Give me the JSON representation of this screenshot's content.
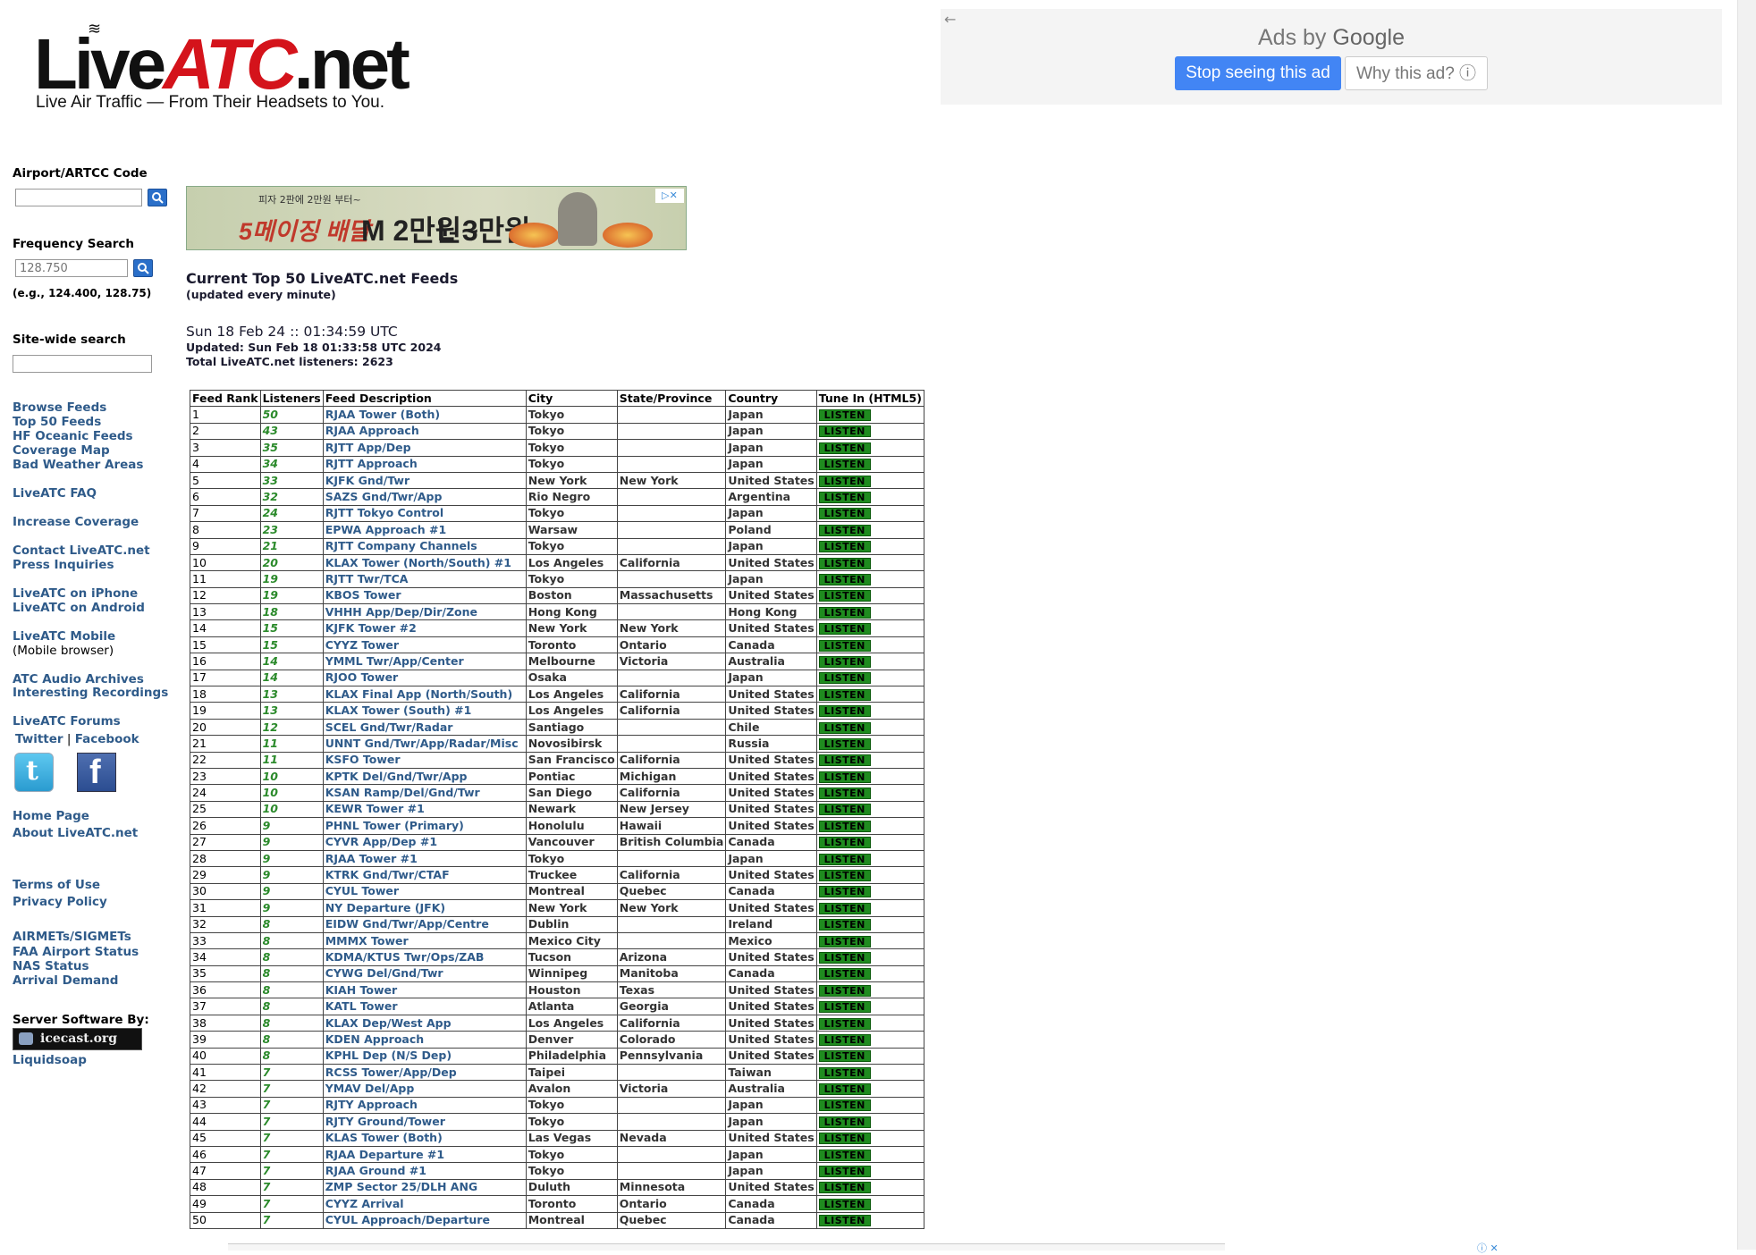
{
  "logo": {
    "live": "Live",
    "atc": "ATC",
    "net": ".net",
    "tagline": "Live Air Traffic — From Their Headsets to You."
  },
  "google_ad": {
    "back": "←",
    "ads_by": "Ads by",
    "google": "Google",
    "stop": "Stop seeing this ad",
    "why": "Why this ad? ⓘ"
  },
  "sidebar": {
    "airport_label": "Airport/ARTCC Code",
    "airport_value": "",
    "freq_label": "Frequency Search",
    "freq_placeholder": "128.750",
    "freq_note": "(e.g., 124.400, 128.75)",
    "site_label": "Site-wide search",
    "links": {
      "browse": "Browse Feeds",
      "top50": "Top 50 Feeds",
      "hf": "HF Oceanic Feeds",
      "coverage_map": "Coverage Map",
      "bad_weather": "Bad Weather Areas",
      "faq": "LiveATC FAQ",
      "increase": "Increase Coverage",
      "contact": "Contact LiveATC.net",
      "press": "Press Inquiries",
      "iphone": "LiveATC on iPhone",
      "android": "LiveATC on Android",
      "mobile": "LiveATC Mobile",
      "mobile_note": "(Mobile browser)",
      "archives": "ATC Audio Archives",
      "recordings": "Interesting Recordings",
      "forums": "LiveATC Forums",
      "twitter": "Twitter",
      "sep": "|",
      "facebook": "Facebook",
      "home": "Home Page",
      "about": "About LiveATC.net",
      "terms": "Terms of Use",
      "privacy": "Privacy Policy",
      "airmets": "AIRMETs/SIGMETs",
      "faa": "FAA Airport Status",
      "nas": "NAS Status",
      "arrival": "Arrival Demand",
      "server_label": "Server Software By:",
      "icecast": "icecast.org",
      "liquidsoap": "Liquidsoap"
    }
  },
  "banner": {
    "line1": "피자 2판에 2만원 부터~",
    "line2": "5메이징 배달",
    "m": "M 2만원~",
    "l": "L 3만원~",
    "ad_mark": "▷✕"
  },
  "main": {
    "title": "Current Top 50 LiveATC.net Feeds",
    "subtitle": "(updated every minute)",
    "now": "Sun 18 Feb 24 :: 01:34:59 UTC",
    "updated": "Updated: Sun Feb 18 01:33:58 UTC 2024",
    "total": "Total LiveATC.net listeners: 2623"
  },
  "table": {
    "headers": [
      "Feed Rank",
      "Listeners",
      "Feed Description",
      "City",
      "State/Province",
      "Country",
      "Tune In (HTML5)"
    ],
    "listen_label": "LISTEN",
    "rows": [
      [
        "1",
        "50",
        "RJAA Tower (Both)",
        "Tokyo",
        "",
        "Japan"
      ],
      [
        "2",
        "43",
        "RJAA Approach",
        "Tokyo",
        "",
        "Japan"
      ],
      [
        "3",
        "35",
        "RJTT App/Dep",
        "Tokyo",
        "",
        "Japan"
      ],
      [
        "4",
        "34",
        "RJTT Approach",
        "Tokyo",
        "",
        "Japan"
      ],
      [
        "5",
        "33",
        "KJFK Gnd/Twr",
        "New York",
        "New York",
        "United States"
      ],
      [
        "6",
        "32",
        "SAZS Gnd/Twr/App",
        "Rio Negro",
        "",
        "Argentina"
      ],
      [
        "7",
        "24",
        "RJTT Tokyo Control",
        "Tokyo",
        "",
        "Japan"
      ],
      [
        "8",
        "23",
        "EPWA Approach #1",
        "Warsaw",
        "",
        "Poland"
      ],
      [
        "9",
        "21",
        "RJTT Company Channels",
        "Tokyo",
        "",
        "Japan"
      ],
      [
        "10",
        "20",
        "KLAX Tower (North/South) #1",
        "Los Angeles",
        "California",
        "United States"
      ],
      [
        "11",
        "19",
        "RJTT Twr/TCA",
        "Tokyo",
        "",
        "Japan"
      ],
      [
        "12",
        "19",
        "KBOS Tower",
        "Boston",
        "Massachusetts",
        "United States"
      ],
      [
        "13",
        "18",
        "VHHH App/Dep/Dir/Zone",
        "Hong Kong",
        "",
        "Hong Kong"
      ],
      [
        "14",
        "15",
        "KJFK Tower #2",
        "New York",
        "New York",
        "United States"
      ],
      [
        "15",
        "15",
        "CYYZ Tower",
        "Toronto",
        "Ontario",
        "Canada"
      ],
      [
        "16",
        "14",
        "YMML Twr/App/Center",
        "Melbourne",
        "Victoria",
        "Australia"
      ],
      [
        "17",
        "14",
        "RJOO Tower",
        "Osaka",
        "",
        "Japan"
      ],
      [
        "18",
        "13",
        "KLAX Final App (North/South)",
        "Los Angeles",
        "California",
        "United States"
      ],
      [
        "19",
        "13",
        "KLAX Tower (South) #1",
        "Los Angeles",
        "California",
        "United States"
      ],
      [
        "20",
        "12",
        "SCEL Gnd/Twr/Radar",
        "Santiago",
        "",
        "Chile"
      ],
      [
        "21",
        "11",
        "UNNT Gnd/Twr/App/Radar/Misc",
        "Novosibirsk",
        "",
        "Russia"
      ],
      [
        "22",
        "11",
        "KSFO Tower",
        "San Francisco",
        "California",
        "United States"
      ],
      [
        "23",
        "10",
        "KPTK Del/Gnd/Twr/App",
        "Pontiac",
        "Michigan",
        "United States"
      ],
      [
        "24",
        "10",
        "KSAN Ramp/Del/Gnd/Twr",
        "San Diego",
        "California",
        "United States"
      ],
      [
        "25",
        "10",
        "KEWR Tower #1",
        "Newark",
        "New Jersey",
        "United States"
      ],
      [
        "26",
        "9",
        "PHNL Tower (Primary)",
        "Honolulu",
        "Hawaii",
        "United States"
      ],
      [
        "27",
        "9",
        "CYVR App/Dep #1",
        "Vancouver",
        "British Columbia",
        "Canada"
      ],
      [
        "28",
        "9",
        "RJAA Tower #1",
        "Tokyo",
        "",
        "Japan"
      ],
      [
        "29",
        "9",
        "KTRK Gnd/Twr/CTAF",
        "Truckee",
        "California",
        "United States"
      ],
      [
        "30",
        "9",
        "CYUL Tower",
        "Montreal",
        "Quebec",
        "Canada"
      ],
      [
        "31",
        "9",
        "NY Departure (JFK)",
        "New York",
        "New York",
        "United States"
      ],
      [
        "32",
        "8",
        "EIDW Gnd/Twr/App/Centre",
        "Dublin",
        "",
        "Ireland"
      ],
      [
        "33",
        "8",
        "MMMX Tower",
        "Mexico City",
        "",
        "Mexico"
      ],
      [
        "34",
        "8",
        "KDMA/KTUS Twr/Ops/ZAB",
        "Tucson",
        "Arizona",
        "United States"
      ],
      [
        "35",
        "8",
        "CYWG Del/Gnd/Twr",
        "Winnipeg",
        "Manitoba",
        "Canada"
      ],
      [
        "36",
        "8",
        "KIAH Tower",
        "Houston",
        "Texas",
        "United States"
      ],
      [
        "37",
        "8",
        "KATL Tower",
        "Atlanta",
        "Georgia",
        "United States"
      ],
      [
        "38",
        "8",
        "KLAX Dep/West App",
        "Los Angeles",
        "California",
        "United States"
      ],
      [
        "39",
        "8",
        "KDEN Approach",
        "Denver",
        "Colorado",
        "United States"
      ],
      [
        "40",
        "8",
        "KPHL Dep (N/S Dep)",
        "Philadelphia",
        "Pennsylvania",
        "United States"
      ],
      [
        "41",
        "7",
        "RCSS Tower/App/Dep",
        "Taipei",
        "",
        "Taiwan"
      ],
      [
        "42",
        "7",
        "YMAV Del/App",
        "Avalon",
        "Victoria",
        "Australia"
      ],
      [
        "43",
        "7",
        "RJTY Approach",
        "Tokyo",
        "",
        "Japan"
      ],
      [
        "44",
        "7",
        "RJTY Ground/Tower",
        "Tokyo",
        "",
        "Japan"
      ],
      [
        "45",
        "7",
        "KLAS Tower (Both)",
        "Las Vegas",
        "Nevada",
        "United States"
      ],
      [
        "46",
        "7",
        "RJAA Departure #1",
        "Tokyo",
        "",
        "Japan"
      ],
      [
        "47",
        "7",
        "RJAA Ground #1",
        "Tokyo",
        "",
        "Japan"
      ],
      [
        "48",
        "7",
        "ZMP Sector 25/DLH ANG",
        "Duluth",
        "Minnesota",
        "United States"
      ],
      [
        "49",
        "7",
        "CYYZ Arrival",
        "Toronto",
        "Ontario",
        "Canada"
      ],
      [
        "50",
        "7",
        "CYUL Approach/Departure",
        "Montreal",
        "Quebec",
        "Canada"
      ]
    ]
  },
  "colors": {
    "link": "#2f5b8a",
    "listeners": "#2b8a2b",
    "listen_button": "#1f8b1f",
    "logo_red": "#d4131b",
    "google_blue": "#4285f4"
  },
  "icons": {
    "search": "search-icon",
    "twitter": "twitter-icon",
    "facebook": "facebook-icon"
  }
}
